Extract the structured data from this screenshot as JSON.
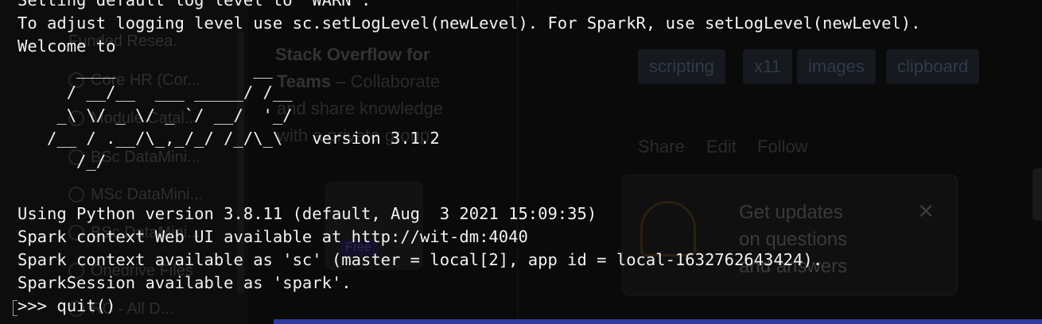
{
  "background": {
    "sidebar_items": [
      "Funded Resea.",
      "Core HR (Cor...",
      "Module Catal...",
      "BSc DataMini...",
      "MSc DataMini...",
      "BSc DataMini...",
      "Onedrive Files",
      "RC - All D..."
    ],
    "so_teams_title": "Stack Overflow for",
    "so_teams_title2": "Teams",
    "so_teams_rest": " – Collaborate",
    "so_teams_line2": "and share knowledge",
    "so_teams_line3": "with a private group.",
    "tags": [
      "scripting",
      "x11",
      "images",
      "clipboard"
    ],
    "post_actions": [
      "Share",
      "Edit",
      "Follow"
    ],
    "card_text": [
      "Get updates",
      "on questions",
      "and answers"
    ],
    "card_close": "✕",
    "dock_badge": "Free"
  },
  "terminal": {
    "lines": [
      "Setting default log level to \"WARN\".",
      "To adjust logging level use sc.setLogLevel(newLevel). For SparkR, use setLogLevel(newLevel).",
      "Welcome to",
      "      ____              __",
      "     / __/__  ___ _____/ /__",
      "    _\\ \\/ _ \\/ _ `/ __/  '_/",
      "   /__ / .__/\\_,_/_/ /_/\\_\\   version 3.1.2",
      "      /_/",
      "",
      "Using Python version 3.8.11 (default, Aug  3 2021 15:09:35)",
      "Spark context Web UI available at http://wit-dm:4040",
      "Spark context available as 'sc' (master = local[2], app id = local-1632762643424).",
      "SparkSession available as 'spark'.",
      ">>> quit()"
    ]
  },
  "colors": {
    "terminal_bg": "#050505",
    "terminal_fg": "#f2f2f2",
    "accent_bar": "#2d3ba3"
  }
}
